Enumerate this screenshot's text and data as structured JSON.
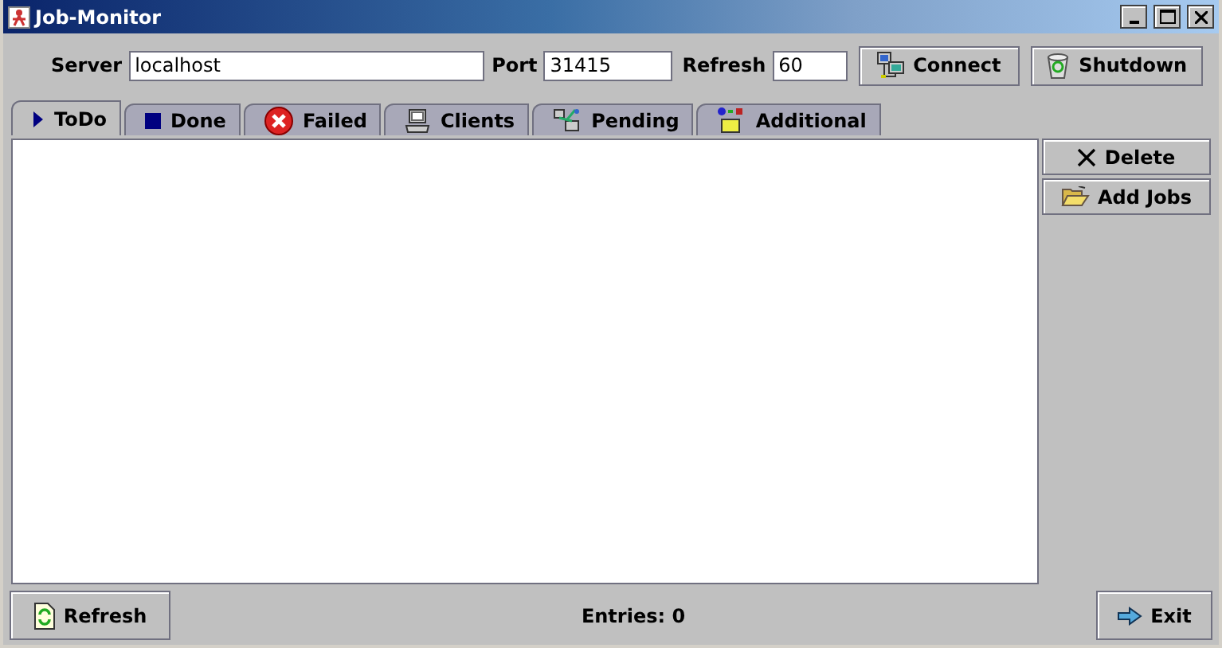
{
  "window": {
    "title": "Job-Monitor"
  },
  "connection": {
    "server_label": "Server",
    "server": "localhost",
    "port_label": "Port",
    "port": "31415",
    "refresh_label": "Refresh",
    "refresh": "60"
  },
  "toolbar_buttons": [
    "Connect",
    "Shutdown"
  ],
  "tabs": [
    {
      "label": "ToDo",
      "selected": true
    },
    {
      "label": "Done",
      "selected": false
    },
    {
      "label": "Failed",
      "selected": false
    },
    {
      "label": "Clients",
      "selected": false
    },
    {
      "label": "Pending",
      "selected": false
    },
    {
      "label": "Additional",
      "selected": false
    }
  ],
  "side_buttons": [
    "Delete",
    "Add Jobs"
  ],
  "status_bar": {
    "refresh_button": "Refresh",
    "entries": "Entries: 0",
    "exit_button": "Exit"
  }
}
